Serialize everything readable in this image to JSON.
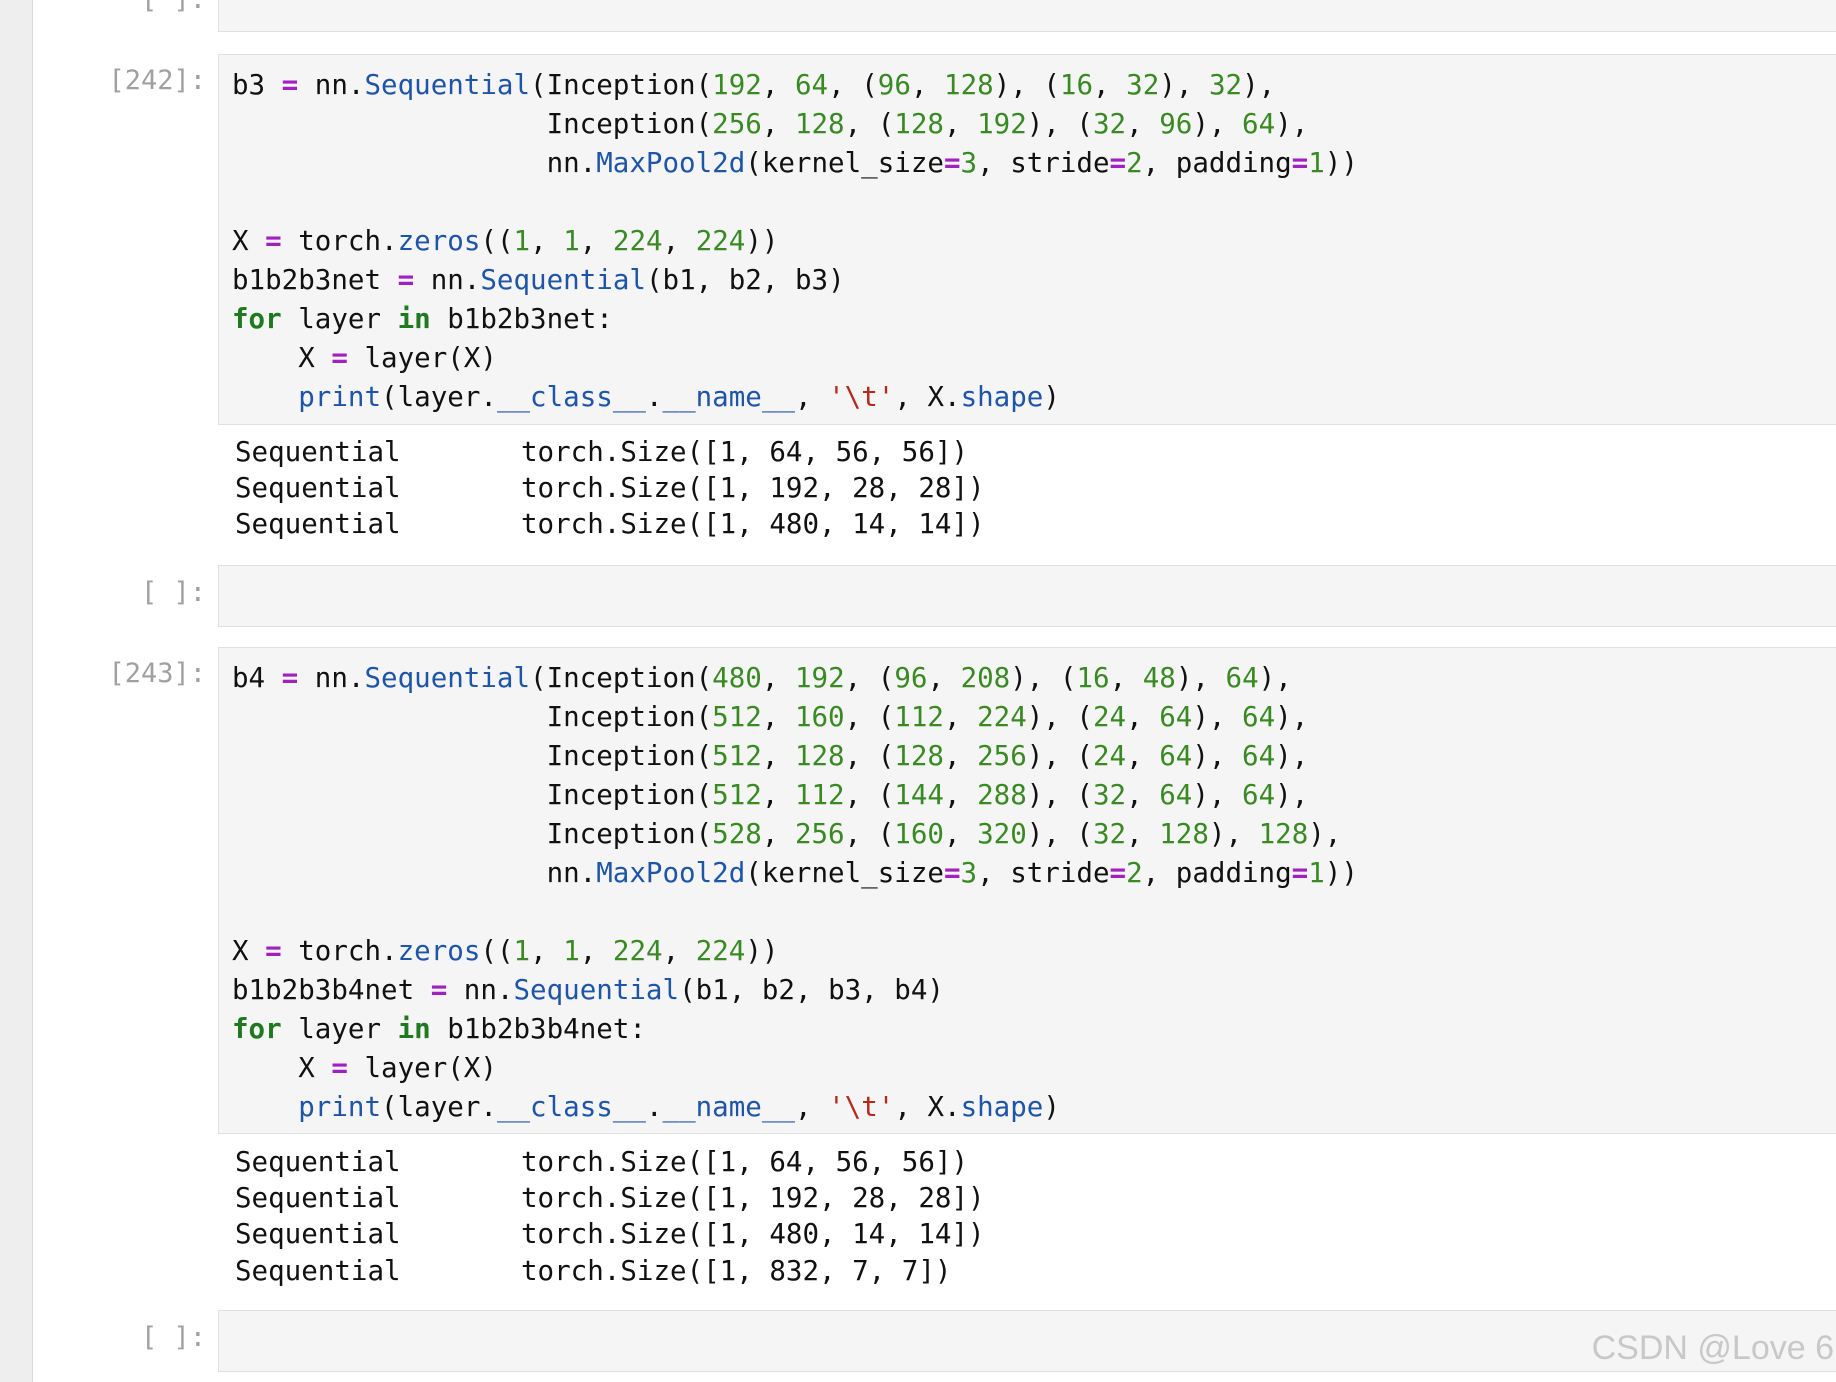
{
  "cells": [
    {
      "prompt": "[ ]:",
      "code_lines": []
    },
    {
      "prompt": "[242]:",
      "code_lines": [
        [
          [
            "t",
            "b3 "
          ],
          [
            "op",
            "="
          ],
          [
            "t",
            " nn."
          ],
          [
            "fn",
            "Sequential"
          ],
          [
            "t",
            "(Inception("
          ],
          [
            "num",
            "192"
          ],
          [
            "t",
            ", "
          ],
          [
            "num",
            "64"
          ],
          [
            "t",
            ", ("
          ],
          [
            "num",
            "96"
          ],
          [
            "t",
            ", "
          ],
          [
            "num",
            "128"
          ],
          [
            "t",
            "), ("
          ],
          [
            "num",
            "16"
          ],
          [
            "t",
            ", "
          ],
          [
            "num",
            "32"
          ],
          [
            "t",
            "), "
          ],
          [
            "num",
            "32"
          ],
          [
            "t",
            "),"
          ]
        ],
        [
          [
            "t",
            "                   Inception("
          ],
          [
            "num",
            "256"
          ],
          [
            "t",
            ", "
          ],
          [
            "num",
            "128"
          ],
          [
            "t",
            ", ("
          ],
          [
            "num",
            "128"
          ],
          [
            "t",
            ", "
          ],
          [
            "num",
            "192"
          ],
          [
            "t",
            "), ("
          ],
          [
            "num",
            "32"
          ],
          [
            "t",
            ", "
          ],
          [
            "num",
            "96"
          ],
          [
            "t",
            "), "
          ],
          [
            "num",
            "64"
          ],
          [
            "t",
            "),"
          ]
        ],
        [
          [
            "t",
            "                   nn."
          ],
          [
            "fn",
            "MaxPool2d"
          ],
          [
            "t",
            "(kernel_size"
          ],
          [
            "op",
            "="
          ],
          [
            "num",
            "3"
          ],
          [
            "t",
            ", stride"
          ],
          [
            "op",
            "="
          ],
          [
            "num",
            "2"
          ],
          [
            "t",
            ", padding"
          ],
          [
            "op",
            "="
          ],
          [
            "num",
            "1"
          ],
          [
            "t",
            "))"
          ]
        ],
        [
          [
            "t",
            ""
          ]
        ],
        [
          [
            "t",
            "X "
          ],
          [
            "op",
            "="
          ],
          [
            "t",
            " torch."
          ],
          [
            "fn",
            "zeros"
          ],
          [
            "t",
            "(("
          ],
          [
            "num",
            "1"
          ],
          [
            "t",
            ", "
          ],
          [
            "num",
            "1"
          ],
          [
            "t",
            ", "
          ],
          [
            "num",
            "224"
          ],
          [
            "t",
            ", "
          ],
          [
            "num",
            "224"
          ],
          [
            "t",
            "))"
          ]
        ],
        [
          [
            "t",
            "b1b2b3net "
          ],
          [
            "op",
            "="
          ],
          [
            "t",
            " nn."
          ],
          [
            "fn",
            "Sequential"
          ],
          [
            "t",
            "(b1, b2, b3)"
          ]
        ],
        [
          [
            "kw",
            "for"
          ],
          [
            "t",
            " layer "
          ],
          [
            "kw",
            "in"
          ],
          [
            "t",
            " b1b2b3net:"
          ]
        ],
        [
          [
            "t",
            "    X "
          ],
          [
            "op",
            "="
          ],
          [
            "t",
            " layer(X)"
          ]
        ],
        [
          [
            "t",
            "    "
          ],
          [
            "fn",
            "print"
          ],
          [
            "t",
            "(layer."
          ],
          [
            "fn",
            "__class__"
          ],
          [
            "t",
            "."
          ],
          [
            "fn",
            "__name__"
          ],
          [
            "t",
            ", "
          ],
          [
            "str",
            "'\\t'"
          ],
          [
            "t",
            ", X."
          ],
          [
            "fn",
            "shape"
          ],
          [
            "t",
            ")"
          ]
        ]
      ],
      "output": [
        {
          "name": "Sequential",
          "size": "torch.Size([1, 64, 56, 56])"
        },
        {
          "name": "Sequential",
          "size": "torch.Size([1, 192, 28, 28])"
        },
        {
          "name": "Sequential",
          "size": "torch.Size([1, 480, 14, 14])"
        }
      ]
    },
    {
      "prompt": "[ ]:",
      "code_lines": []
    },
    {
      "prompt": "[243]:",
      "code_lines": [
        [
          [
            "t",
            "b4 "
          ],
          [
            "op",
            "="
          ],
          [
            "t",
            " nn."
          ],
          [
            "fn",
            "Sequential"
          ],
          [
            "t",
            "(Inception("
          ],
          [
            "num",
            "480"
          ],
          [
            "t",
            ", "
          ],
          [
            "num",
            "192"
          ],
          [
            "t",
            ", ("
          ],
          [
            "num",
            "96"
          ],
          [
            "t",
            ", "
          ],
          [
            "num",
            "208"
          ],
          [
            "t",
            "), ("
          ],
          [
            "num",
            "16"
          ],
          [
            "t",
            ", "
          ],
          [
            "num",
            "48"
          ],
          [
            "t",
            "), "
          ],
          [
            "num",
            "64"
          ],
          [
            "t",
            "),"
          ]
        ],
        [
          [
            "t",
            "                   Inception("
          ],
          [
            "num",
            "512"
          ],
          [
            "t",
            ", "
          ],
          [
            "num",
            "160"
          ],
          [
            "t",
            ", ("
          ],
          [
            "num",
            "112"
          ],
          [
            "t",
            ", "
          ],
          [
            "num",
            "224"
          ],
          [
            "t",
            "), ("
          ],
          [
            "num",
            "24"
          ],
          [
            "t",
            ", "
          ],
          [
            "num",
            "64"
          ],
          [
            "t",
            "), "
          ],
          [
            "num",
            "64"
          ],
          [
            "t",
            "),"
          ]
        ],
        [
          [
            "t",
            "                   Inception("
          ],
          [
            "num",
            "512"
          ],
          [
            "t",
            ", "
          ],
          [
            "num",
            "128"
          ],
          [
            "t",
            ", ("
          ],
          [
            "num",
            "128"
          ],
          [
            "t",
            ", "
          ],
          [
            "num",
            "256"
          ],
          [
            "t",
            "), ("
          ],
          [
            "num",
            "24"
          ],
          [
            "t",
            ", "
          ],
          [
            "num",
            "64"
          ],
          [
            "t",
            "), "
          ],
          [
            "num",
            "64"
          ],
          [
            "t",
            "),"
          ]
        ],
        [
          [
            "t",
            "                   Inception("
          ],
          [
            "num",
            "512"
          ],
          [
            "t",
            ", "
          ],
          [
            "num",
            "112"
          ],
          [
            "t",
            ", ("
          ],
          [
            "num",
            "144"
          ],
          [
            "t",
            ", "
          ],
          [
            "num",
            "288"
          ],
          [
            "t",
            "), ("
          ],
          [
            "num",
            "32"
          ],
          [
            "t",
            ", "
          ],
          [
            "num",
            "64"
          ],
          [
            "t",
            "), "
          ],
          [
            "num",
            "64"
          ],
          [
            "t",
            "),"
          ]
        ],
        [
          [
            "t",
            "                   Inception("
          ],
          [
            "num",
            "528"
          ],
          [
            "t",
            ", "
          ],
          [
            "num",
            "256"
          ],
          [
            "t",
            ", ("
          ],
          [
            "num",
            "160"
          ],
          [
            "t",
            ", "
          ],
          [
            "num",
            "320"
          ],
          [
            "t",
            "), ("
          ],
          [
            "num",
            "32"
          ],
          [
            "t",
            ", "
          ],
          [
            "num",
            "128"
          ],
          [
            "t",
            "), "
          ],
          [
            "num",
            "128"
          ],
          [
            "t",
            "),"
          ]
        ],
        [
          [
            "t",
            "                   nn."
          ],
          [
            "fn",
            "MaxPool2d"
          ],
          [
            "t",
            "(kernel_size"
          ],
          [
            "op",
            "="
          ],
          [
            "num",
            "3"
          ],
          [
            "t",
            ", stride"
          ],
          [
            "op",
            "="
          ],
          [
            "num",
            "2"
          ],
          [
            "t",
            ", padding"
          ],
          [
            "op",
            "="
          ],
          [
            "num",
            "1"
          ],
          [
            "t",
            "))"
          ]
        ],
        [
          [
            "t",
            ""
          ]
        ],
        [
          [
            "t",
            "X "
          ],
          [
            "op",
            "="
          ],
          [
            "t",
            " torch."
          ],
          [
            "fn",
            "zeros"
          ],
          [
            "t",
            "(("
          ],
          [
            "num",
            "1"
          ],
          [
            "t",
            ", "
          ],
          [
            "num",
            "1"
          ],
          [
            "t",
            ", "
          ],
          [
            "num",
            "224"
          ],
          [
            "t",
            ", "
          ],
          [
            "num",
            "224"
          ],
          [
            "t",
            "))"
          ]
        ],
        [
          [
            "t",
            "b1b2b3b4net "
          ],
          [
            "op",
            "="
          ],
          [
            "t",
            " nn."
          ],
          [
            "fn",
            "Sequential"
          ],
          [
            "t",
            "(b1, b2, b3, b4)"
          ]
        ],
        [
          [
            "kw",
            "for"
          ],
          [
            "t",
            " layer "
          ],
          [
            "kw",
            "in"
          ],
          [
            "t",
            " b1b2b3b4net:"
          ]
        ],
        [
          [
            "t",
            "    X "
          ],
          [
            "op",
            "="
          ],
          [
            "t",
            " layer(X)"
          ]
        ],
        [
          [
            "t",
            "    "
          ],
          [
            "fn",
            "print"
          ],
          [
            "t",
            "(layer."
          ],
          [
            "fn",
            "__class__"
          ],
          [
            "t",
            "."
          ],
          [
            "fn",
            "__name__"
          ],
          [
            "t",
            ", "
          ],
          [
            "str",
            "'\\t'"
          ],
          [
            "t",
            ", X."
          ],
          [
            "fn",
            "shape"
          ],
          [
            "t",
            ")"
          ]
        ]
      ],
      "output": [
        {
          "name": "Sequential",
          "size": "torch.Size([1, 64, 56, 56])"
        },
        {
          "name": "Sequential",
          "size": "torch.Size([1, 192, 28, 28])"
        },
        {
          "name": "Sequential",
          "size": "torch.Size([1, 480, 14, 14])"
        },
        {
          "name": "Sequential",
          "size": "torch.Size([1, 832, 7, 7])"
        }
      ]
    },
    {
      "prompt": "[ ]:",
      "code_lines": []
    }
  ],
  "watermark": "CSDN @Love 6"
}
